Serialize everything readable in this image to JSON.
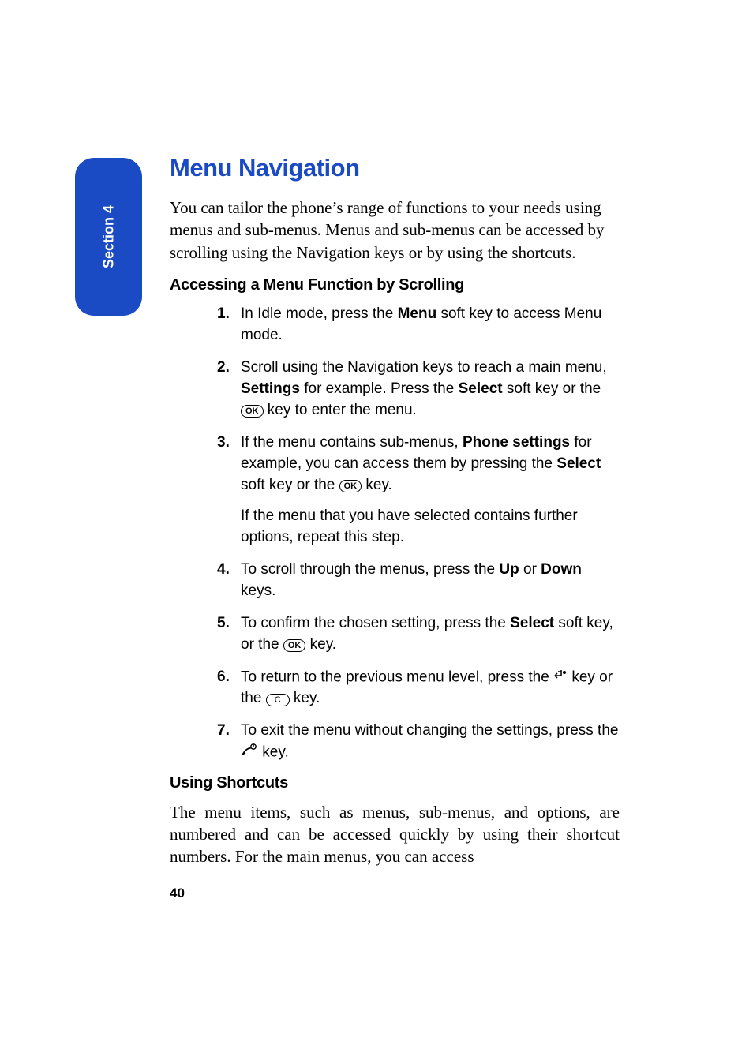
{
  "side_tab": "Section 4",
  "title": "Menu Navigation",
  "intro": "You can tailor the phone’s range of functions to your needs using menus and sub-menus. Menus and sub-menus can be accessed by scrolling using the Navigation keys or by using the shortcuts.",
  "h2a": "Accessing a Menu Function by Scrolling",
  "steps": {
    "s1a": "In Idle mode, press the ",
    "s1b": "Menu",
    "s1c": " soft key to access Menu mode.",
    "s2a": "Scroll using the Navigation keys to reach a main menu, ",
    "s2b": "Settings",
    "s2c": " for example. Press the ",
    "s2d": "Select",
    "s2e": " soft key or the ",
    "s2f": " key to enter the menu.",
    "s3a": "If the menu contains sub-menus, ",
    "s3b": "Phone settings",
    "s3c": " for example, you can access them by pressing the ",
    "s3d": "Select",
    "s3e": " soft key or the ",
    "s3f": " key.",
    "s3g": "If the menu that you have selected contains further options, repeat this step.",
    "s4a": "To scroll through the menus, press the ",
    "s4b": "Up",
    "s4c": " or ",
    "s4d": "Down",
    "s4e": " keys.",
    "s5a": "To confirm the chosen setting, press the ",
    "s5b": "Select",
    "s5c": " soft key, or the ",
    "s5d": " key.",
    "s6a": "To return to the previous menu level, press the ",
    "s6b": " key or the ",
    "s6c": " key.",
    "s7a": "To exit the menu without changing the settings, press the ",
    "s7b": " key."
  },
  "ok_label": "OK",
  "c_label": "C",
  "h2b": "Using Shortcuts",
  "shortcuts_p": "The menu items, such as menus, sub-menus, and options, are numbered and can be accessed quickly by using their shortcut numbers. For the main menus, you can access",
  "page_number": "40"
}
